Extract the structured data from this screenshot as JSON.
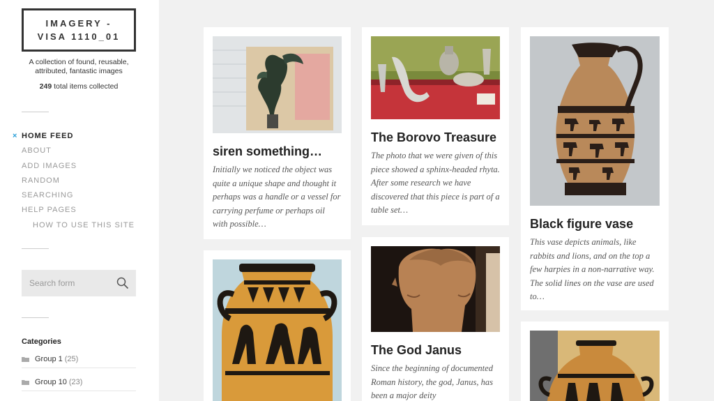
{
  "site": {
    "title_line1": "IMAGERY -",
    "title_line2": "VISA 1110_01",
    "tagline": "A collection of found, reusable, attributed, fantastic images",
    "count_number": "249",
    "count_label": "total items collected"
  },
  "nav": {
    "active_marker": "×",
    "items": [
      {
        "label": "HOME FEED"
      },
      {
        "label": "ABOUT"
      },
      {
        "label": "ADD IMAGES"
      },
      {
        "label": "RANDOM"
      },
      {
        "label": "SEARCHING"
      },
      {
        "label": "HELP PAGES"
      },
      {
        "label": "HOW TO USE THIS SITE"
      }
    ]
  },
  "search": {
    "placeholder": "Search form",
    "icon": "magnifier-icon"
  },
  "categories": {
    "title": "Categories",
    "items": [
      {
        "name": "Group 1",
        "count": "(25)"
      },
      {
        "name": "Group 10",
        "count": "(23)"
      }
    ]
  },
  "cards": [
    {
      "title": "siren something…",
      "excerpt": "Initially we noticed the object was quite a unique shape and thought it perhaps was a handle or a vessel for carrying perfume or perhaps oil with possible…"
    },
    {
      "title": "The Borovo Treasure",
      "excerpt": "The photo that we were given of this piece showed a sphinx-headed rhyta. After some research we have discovered that this piece is part of a table set…"
    },
    {
      "title": "Black figure vase",
      "excerpt": "This vase depicts animals, like rabbits and lions, and on the top a few harpies in a non-narrative way. The solid lines on the vase are used to…"
    },
    {
      "title": "",
      "excerpt": ""
    },
    {
      "title": "The God Janus",
      "excerpt": "Since the beginning of documented Roman history, the god, Janus, has been a major deity"
    },
    {
      "title": "",
      "excerpt": ""
    }
  ],
  "colors": {
    "accent": "#2a9fd8",
    "background": "#f1f1f1",
    "text": "#333333"
  }
}
